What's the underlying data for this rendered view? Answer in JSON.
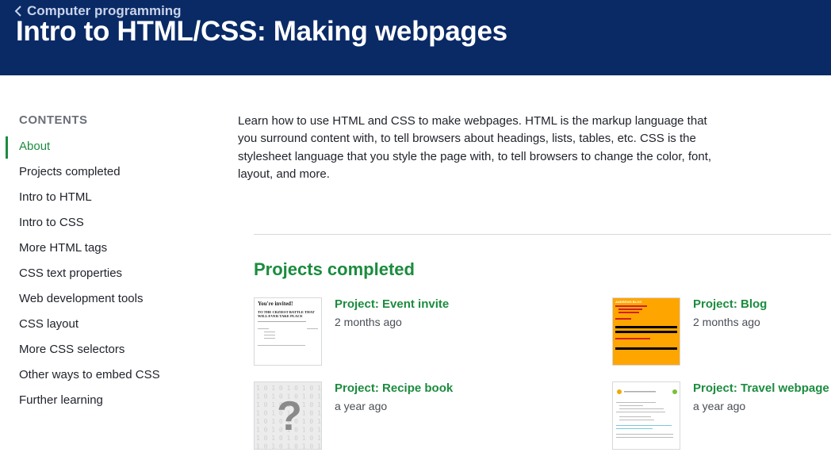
{
  "header": {
    "breadcrumb_label": "Computer programming",
    "title": "Intro to HTML/CSS: Making webpages"
  },
  "sidebar": {
    "heading": "CONTENTS",
    "items": [
      {
        "label": "About",
        "active": true
      },
      {
        "label": "Projects completed",
        "active": false
      },
      {
        "label": "Intro to HTML",
        "active": false
      },
      {
        "label": "Intro to CSS",
        "active": false
      },
      {
        "label": "More HTML tags",
        "active": false
      },
      {
        "label": "CSS text properties",
        "active": false
      },
      {
        "label": "Web development tools",
        "active": false
      },
      {
        "label": "CSS layout",
        "active": false
      },
      {
        "label": "More CSS selectors",
        "active": false
      },
      {
        "label": "Other ways to embed CSS",
        "active": false
      },
      {
        "label": "Further learning",
        "active": false
      }
    ]
  },
  "about": {
    "text": "Learn how to use HTML and CSS to make webpages. HTML is the markup language that you surround content with, to tell browsers about headings, lists, tables, etc. CSS is the stylesheet language that you style the page with, to tell browsers to change the color, font, layout, and more."
  },
  "projects": {
    "heading": "Projects completed",
    "cards": [
      {
        "title": "Project: Event invite",
        "time": "2 months ago"
      },
      {
        "title": "Project: Blog",
        "time": "2 months ago"
      },
      {
        "title": "Project: Recipe book",
        "time": "a year ago"
      },
      {
        "title": "Project: Travel webpage",
        "time": "a year ago"
      }
    ],
    "thumbs": {
      "invite_heading": "You're invited!",
      "invite_subheading": "TO THE CRZIEST BATTLE THAT WILL EVER TAKE PLACE",
      "blog_heading": "ANDREWS BLOG",
      "recipe_digits": "1 0 1 0 1 0 1 0 1"
    }
  },
  "colors": {
    "header_bg": "#0a2a66",
    "accent_green": "#1b8c3e",
    "blog_orange": "#ffa500"
  },
  "icons": {
    "breadcrumb": "chevron-left-icon",
    "recipe_placeholder": "question-mark-icon"
  }
}
